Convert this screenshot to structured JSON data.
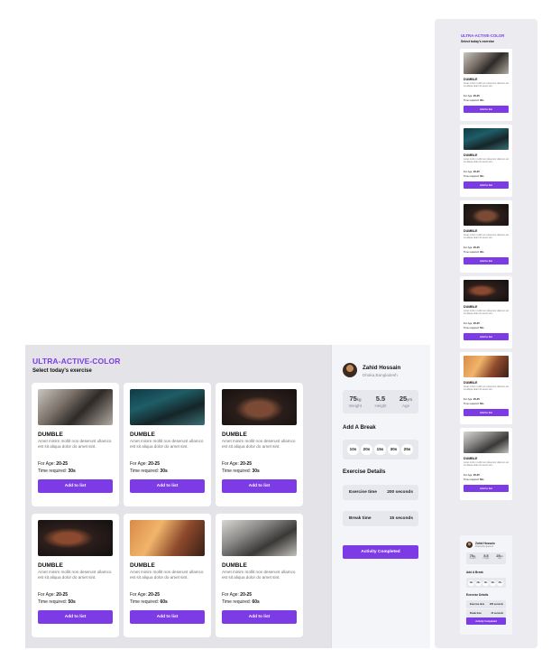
{
  "app": {
    "title": "ULTRA-ACTIVE-COLOR",
    "subtitle": "Select today's exercise",
    "accent_color": "#7c3be5"
  },
  "exercises": [
    {
      "name": "DUMBLE",
      "description": "Amet minim mollit non deserunt ullamco est sit aliqua dolor do amet sint.",
      "age_label": "For Age:",
      "age_value": "20-25",
      "time_label": "Time required:",
      "time_value": "30s",
      "button": "Add to list",
      "image": "gym-deadlift-photo"
    },
    {
      "name": "DUMBLE",
      "description": "Amet minim mollit non deserunt ullamco est sit aliqua dolor do amet sint.",
      "age_label": "For Age:",
      "age_value": "20-25",
      "time_label": "Time required:",
      "time_value": "30s",
      "button": "Add to list",
      "image": "kettlebell-lift-photo"
    },
    {
      "name": "DUMBLE",
      "description": "Amet minim mollit non deserunt ullamco est sit aliqua dolor do amet sint.",
      "age_label": "For Age:",
      "age_value": "20-25",
      "time_label": "Time required:",
      "time_value": "30s",
      "button": "Add to list",
      "image": "back-muscles-photo"
    },
    {
      "name": "DUMBLE",
      "description": "Amet minim mollit non deserunt ullamco est sit aliqua dolor do amet sint.",
      "age_label": "For Age:",
      "age_value": "20-25",
      "time_label": "Time required:",
      "time_value": "50s",
      "button": "Add to list",
      "image": "bodybuilder-photo"
    },
    {
      "name": "DUMBLE",
      "description": "Amet minim mollit non deserunt ullamco est sit aliqua dolor do amet sint.",
      "age_label": "For Age:",
      "age_value": "20-25",
      "time_label": "Time required:",
      "time_value": "60s",
      "button": "Add to list",
      "image": "dumbbell-curl-photo"
    },
    {
      "name": "DUMBLE",
      "description": "Amet minim mollit non deserunt ullamco est sit aliqua dolor do amet sint.",
      "age_label": "For Age:",
      "age_value": "20-25",
      "time_label": "Time required:",
      "time_value": "60s",
      "button": "Add to list",
      "image": "dumbbell-rack-photo"
    }
  ],
  "profile": {
    "name": "Zahid Hossain",
    "location": "Dhaka,Bangladesh",
    "stats": [
      {
        "value": "75",
        "unit": "kg",
        "label": "Weight"
      },
      {
        "value": "5.5",
        "unit": "",
        "label": "Height"
      },
      {
        "value": "25",
        "unit": "yrs",
        "label": "Age"
      }
    ]
  },
  "breaks": {
    "title": "Add A Break",
    "options": [
      "10s",
      "20s",
      "15s",
      "30s",
      "25s"
    ]
  },
  "details": {
    "title": "Exercise Details",
    "exercise_time_label": "Exercise time",
    "exercise_time_value": "200 seconds",
    "break_time_label": "Break time",
    "break_time_value": "15 seconds"
  },
  "complete_button": "Activity Completed"
}
